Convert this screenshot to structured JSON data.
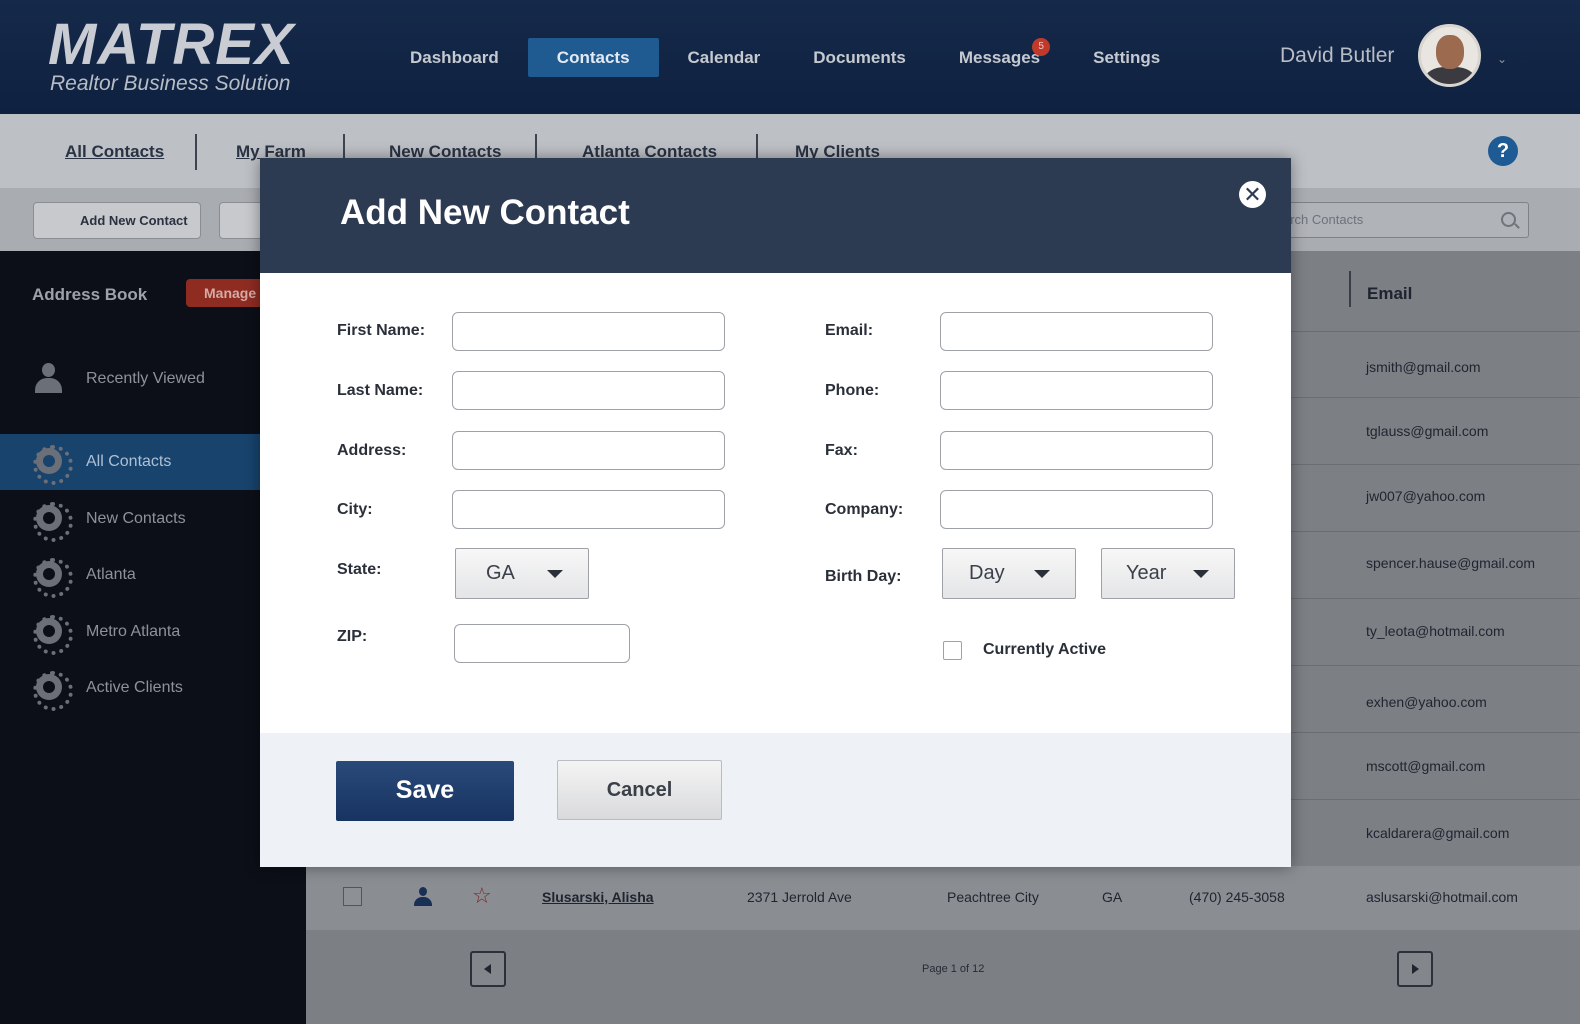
{
  "app": {
    "logo": "MATREX",
    "tagline": "Realtor Business Solution"
  },
  "nav": {
    "items": [
      {
        "label": "Dashboard"
      },
      {
        "label": "Contacts",
        "active": true
      },
      {
        "label": "Calendar"
      },
      {
        "label": "Documents"
      },
      {
        "label": "Messages",
        "badge": "5"
      },
      {
        "label": "Settings"
      }
    ]
  },
  "user": {
    "name": "David Butler"
  },
  "subtabs": [
    "All Contacts",
    "My Farm",
    "New Contacts",
    "Atlanta Contacts",
    "My Clients"
  ],
  "help_label": "?",
  "toolbar": {
    "add_contact_label": "Add New Contact",
    "search_placeholder": "arch Contacts"
  },
  "sidebar": {
    "title": "Address Book",
    "manage_label": "Manage",
    "items": [
      {
        "label": "Recently Viewed"
      },
      {
        "label": "All Contacts",
        "active": true
      },
      {
        "label": "New Contacts"
      },
      {
        "label": "Atlanta"
      },
      {
        "label": "Metro Atlanta"
      },
      {
        "label": "Active Clients"
      }
    ]
  },
  "table": {
    "email_header": "Email",
    "emails": [
      "jsmith@gmail.com",
      "tglauss@gmail.com",
      "jw007@yahoo.com",
      "spencer.hause@gmail.com",
      "ty_leota@hotmail.com",
      "exhen@yahoo.com",
      "mscott@gmail.com",
      "kcaldarera@gmail.com"
    ],
    "last_row": {
      "name": "Slusarski, Alisha",
      "address": "2371 Jerrold Ave",
      "city": "Peachtree City",
      "state": "GA",
      "phone": "(470) 245-3058",
      "email": "aslusarski@hotmail.com"
    },
    "page_text": "Page 1 of 12"
  },
  "modal": {
    "title": "Add New Contact",
    "close_label": "✕",
    "labels": {
      "first_name": "First Name:",
      "last_name": "Last Name:",
      "address": "Address:",
      "city": "City:",
      "state": "State:",
      "zip": "ZIP:",
      "email": "Email:",
      "phone": "Phone:",
      "fax": "Fax:",
      "company": "Company:",
      "birthday": "Birth Day:",
      "active": "Currently Active"
    },
    "state_value": "GA",
    "day_value": "Day",
    "year_value": "Year",
    "save_label": "Save",
    "cancel_label": "Cancel"
  },
  "colors": {
    "header_bg": "#15294a",
    "accent": "#1f5a90",
    "modal_header": "#2c3a52",
    "save_button": "#1e3c6c",
    "manage_badge": "#8e2c22"
  }
}
